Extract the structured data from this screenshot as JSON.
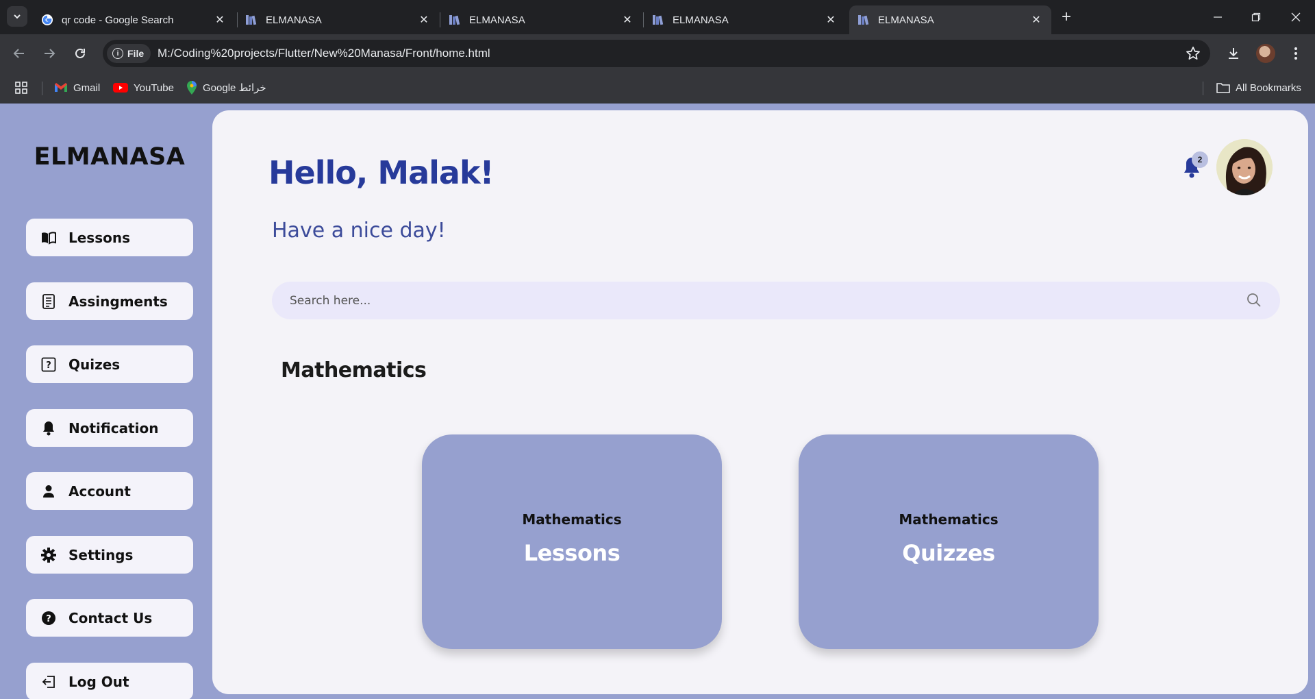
{
  "browser": {
    "tabs": [
      {
        "title": "qr code - Google Search",
        "favicon": "google-icon"
      },
      {
        "title": "ELMANASA",
        "favicon": "books-icon"
      },
      {
        "title": "ELMANASA",
        "favicon": "books-icon"
      },
      {
        "title": "ELMANASA",
        "favicon": "books-icon"
      },
      {
        "title": "ELMANASA",
        "favicon": "books-icon",
        "active": true
      }
    ],
    "url_chip": "File",
    "url": "M:/Coding%20projects/Flutter/New%20Manasa/Front/home.html",
    "bookmarks": [
      {
        "label": "Gmail",
        "icon": "gmail-icon"
      },
      {
        "label": "YouTube",
        "icon": "youtube-icon"
      },
      {
        "label": "Google خرائط",
        "icon": "maps-icon"
      }
    ],
    "all_bookmarks": "All Bookmarks"
  },
  "sidebar": {
    "brand": "ELMANASA",
    "items": [
      {
        "label": "Lessons",
        "icon": "book-icon"
      },
      {
        "label": "Assingments",
        "icon": "list-icon"
      },
      {
        "label": "Quizes",
        "icon": "question-icon"
      },
      {
        "label": "Notification",
        "icon": "bell-icon"
      },
      {
        "label": "Account",
        "icon": "user-icon"
      },
      {
        "label": "Settings",
        "icon": "gear-icon"
      },
      {
        "label": "Contact Us",
        "icon": "help-icon"
      },
      {
        "label": "Log Out",
        "icon": "logout-icon"
      }
    ]
  },
  "main": {
    "greeting": "Hello, Malak!",
    "subgreeting": "Have a nice day!",
    "notification_count": "2",
    "search_placeholder": "Search here...",
    "section_title": "Mathematics",
    "cards": [
      {
        "subtitle": "Mathematics",
        "title": "Lessons"
      },
      {
        "subtitle": "Mathematics",
        "title": "Quizzes"
      }
    ]
  },
  "colors": {
    "sidebar_bg": "#96a0cf",
    "accent": "#273a9a",
    "panel_bg": "#f4f3f8",
    "search_bg": "#eae8fa",
    "card_bg": "#96a0cf"
  }
}
